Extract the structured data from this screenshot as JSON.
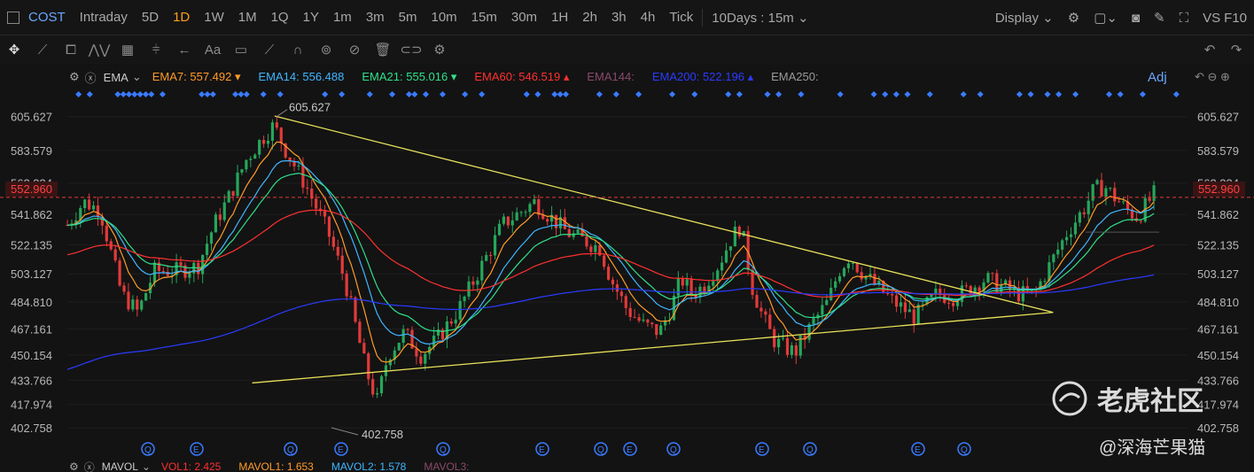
{
  "topbar": {
    "symbol": "COST",
    "periods": [
      "Intraday",
      "5D",
      "1D",
      "1W",
      "1M",
      "1Q",
      "1Y",
      "1m",
      "3m",
      "5m",
      "10m",
      "15m",
      "30m",
      "1H",
      "2h",
      "3h",
      "4h",
      "Tick"
    ],
    "active_period": "1D",
    "range_label": "10Days : 15m",
    "display_label": "Display",
    "vs_label": "VS",
    "f10_label": "F10"
  },
  "toolbar": {
    "text_tool": "Aa",
    "icons": [
      "crosshair-icon",
      "line-tool-icon",
      "rectangle-tool-icon",
      "zigzag-tool-icon",
      "fib-tool-icon",
      "channel-tool-icon",
      "arrow-tool-icon",
      "text-tool-icon",
      "comment-tool-icon",
      "pencil-tool-icon",
      "magnet-icon",
      "eye-icon",
      "hide-icon",
      "trash-icon",
      "link-icon",
      "settings-icon"
    ]
  },
  "legend": {
    "indicator": "EMA",
    "items": [
      {
        "label": "EMA7:",
        "value": "557.492",
        "arrow": "down",
        "color": "#ff9b2a"
      },
      {
        "label": "EMA14:",
        "value": "556.488",
        "arrow": "",
        "color": "#3fb6ff"
      },
      {
        "label": "EMA21:",
        "value": "555.016",
        "arrow": "down",
        "color": "#2fe08a"
      },
      {
        "label": "EMA60:",
        "value": "546.519",
        "arrow": "up",
        "color": "#ff3030"
      },
      {
        "label": "EMA144:",
        "value": "",
        "arrow": "",
        "color": "#8a4a6a"
      },
      {
        "label": "EMA200:",
        "value": "522.196",
        "arrow": "up",
        "color": "#2a3bff"
      },
      {
        "label": "EMA250:",
        "value": "",
        "arrow": "",
        "color": "#9a9a9a"
      }
    ],
    "adj": "Adj"
  },
  "chart_data": {
    "type": "candlestick",
    "y_ticks": [
      "605.627",
      "583.579",
      "562.334",
      "541.862",
      "522.135",
      "503.127",
      "484.810",
      "467.161",
      "450.154",
      "433.766",
      "417.974",
      "402.758"
    ],
    "ylim": [
      393,
      617
    ],
    "current_price": "552.960",
    "high_label": "605.627",
    "low_label": "402.758",
    "event_markers": [
      "Q",
      "E",
      "Q",
      "E",
      "Q",
      "E",
      "Q",
      "E",
      "Q",
      "E",
      "Q",
      "E"
    ],
    "trendlines": [
      {
        "name": "upper",
        "from": [
          0.185,
          606
        ],
        "to": [
          0.88,
          478
        ]
      },
      {
        "name": "lower",
        "from": [
          0.165,
          432
        ],
        "to": [
          0.88,
          478
        ]
      }
    ]
  },
  "bottom_legend": {
    "indicator": "MAVOL",
    "items": [
      {
        "label": "VOL1:",
        "value": "2.425",
        "color": "#ff3030"
      },
      {
        "label": "MAVOL1:",
        "value": "1.653",
        "color": "#ff9b2a"
      },
      {
        "label": "MAVOL2:",
        "value": "1.578",
        "color": "#3fb6ff"
      },
      {
        "label": "MAVOL3:",
        "value": "",
        "color": "#8a4a6a"
      }
    ]
  },
  "watermark": {
    "brand": "老虎社区",
    "author": "@深海芒果猫"
  },
  "colors": {
    "up": "#26a65b",
    "down": "#e23a3a",
    "trendline": "#e8e05a",
    "accent": "#ff9f1a"
  }
}
